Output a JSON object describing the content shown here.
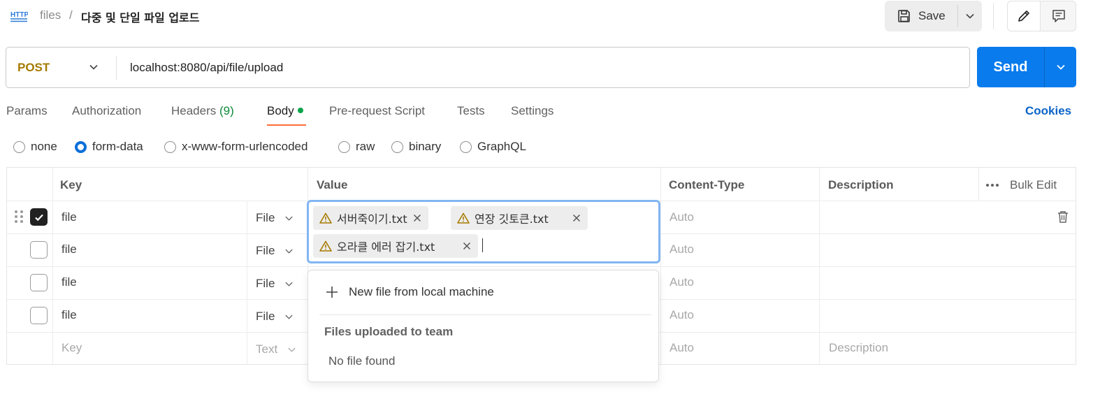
{
  "header": {
    "breadcrumb_root": "files",
    "breadcrumb_sep": "/",
    "title": "다중 및 단일 파일 업로드",
    "save_label": "Save",
    "icons": [
      "http-icon",
      "save-icon",
      "chevron-down-icon",
      "pencil-icon",
      "comment-icon"
    ]
  },
  "request": {
    "method": "POST",
    "url": "localhost:8080/api/file/upload",
    "send_label": "Send"
  },
  "tabs": [
    {
      "label": "Params"
    },
    {
      "label": "Authorization"
    },
    {
      "label": "Headers",
      "count": "(9)"
    },
    {
      "label": "Body",
      "active": true
    },
    {
      "label": "Pre-request Script"
    },
    {
      "label": "Tests"
    },
    {
      "label": "Settings"
    }
  ],
  "cookies_label": "Cookies",
  "body_modes": [
    {
      "label": "none",
      "selected": false
    },
    {
      "label": "form-data",
      "selected": true
    },
    {
      "label": "x-www-form-urlencoded",
      "selected": false
    },
    {
      "label": "raw",
      "selected": false
    },
    {
      "label": "binary",
      "selected": false
    },
    {
      "label": "GraphQL",
      "selected": false
    }
  ],
  "table": {
    "headers": {
      "key": "Key",
      "value": "Value",
      "content_type": "Content-Type",
      "description": "Description",
      "bulk_edit": "Bulk Edit"
    },
    "rows": [
      {
        "checked": true,
        "key": "file",
        "type": "File",
        "content_type": "Auto"
      },
      {
        "checked": false,
        "key": "file",
        "type": "File",
        "content_type": "Auto"
      },
      {
        "checked": false,
        "key": "file",
        "type": "File",
        "content_type": "Auto"
      },
      {
        "checked": false,
        "key": "file",
        "type": "File",
        "content_type": "Auto"
      }
    ],
    "placeholder_row": {
      "key": "Key",
      "type": "Text",
      "content_type": "Auto",
      "description": "Description"
    }
  },
  "value_files": [
    "서버죽이기.txt",
    "연장 깃토큰.txt",
    "오라클 에러 잡기.txt"
  ],
  "file_dropdown": {
    "new_file": "New file from local machine",
    "team_header": "Files uploaded to team",
    "empty": "No file found"
  },
  "colors": {
    "accent": "#097bed",
    "method": "#a67a00",
    "tab_active_underline": "#ff6c37",
    "focus_border": "#82b6f2"
  }
}
